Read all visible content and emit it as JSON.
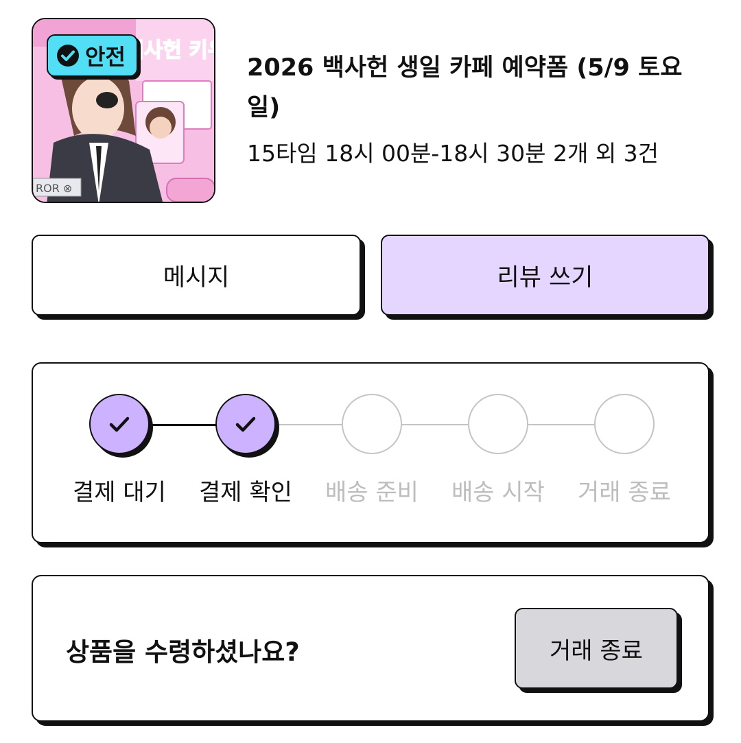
{
  "product": {
    "badge_label": "안전",
    "title": "2026 백사헌 생일 카페 예약폼 (5/9 토요일)",
    "option_summary": "15타임 18시 00분-18시 30분 2개 외 3건",
    "thumbnail_alt": "백사헌 키우기"
  },
  "actions": {
    "message_label": "메시지",
    "review_label": "리뷰 쓰기"
  },
  "progress": {
    "steps": [
      {
        "label": "결제 대기",
        "status": "done"
      },
      {
        "label": "결제 확인",
        "status": "done"
      },
      {
        "label": "배송 준비",
        "status": "pending"
      },
      {
        "label": "배송 시작",
        "status": "pending"
      },
      {
        "label": "거래 종료",
        "status": "pending"
      }
    ]
  },
  "receipt": {
    "question": "상품을 수령하셨나요?",
    "finish_label": "거래 종료"
  },
  "colors": {
    "accent_purple": "#cdb3ff",
    "review_button_bg": "#e4d6ff",
    "safe_badge_bg": "#52dff5",
    "pending_gray": "#bdbdbd",
    "finish_button_bg": "#d8d8dc"
  }
}
